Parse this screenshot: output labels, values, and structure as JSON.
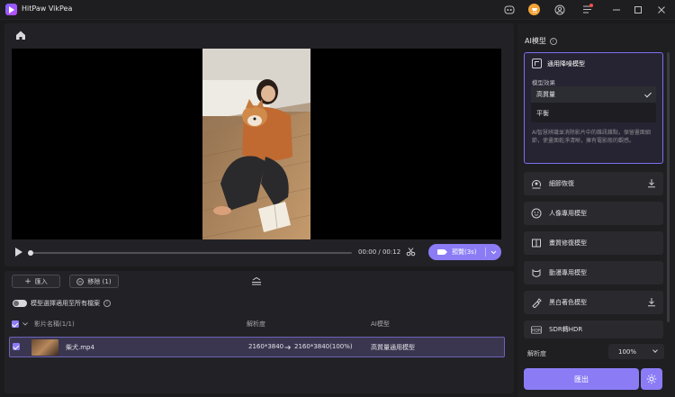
{
  "app": {
    "title": "HitPaw VikPea"
  },
  "titlebar": {
    "icons": [
      "discord-icon",
      "cart-icon",
      "account-icon",
      "menu-icon",
      "minimize-icon",
      "maximize-icon",
      "close-icon"
    ]
  },
  "player": {
    "time": "00:00 / 00:12",
    "preview_label": "預覽(3s)"
  },
  "file_list": {
    "import_label": "匯入",
    "remove_label": "移除 (1)",
    "apply_all_label": "模型選擇適用至所有檔案",
    "headers": {
      "name": "影片名稱(1/1)",
      "resolution": "解析度",
      "model": "AI模型"
    },
    "rows": [
      {
        "name": "柴犬.mp4",
        "res_from": "2160*3840",
        "res_to": "2160*3840(100%)",
        "model": "高質量通用模型"
      }
    ]
  },
  "right_panel": {
    "title": "AI模型",
    "active_model": {
      "name": "通用降噪模型",
      "effect_label": "模型效果",
      "options": [
        "高質量",
        "平衡"
      ],
      "selected": "高質量",
      "description": "AI智慧辨識並消除影片中的雜訊雜點，保留畫面細節，使畫面乾淨清晰，擁有電影般的觀感。"
    },
    "models": [
      {
        "name": "細節恢復",
        "icon": "detail-restore-icon",
        "download": true
      },
      {
        "name": "人像專用模型",
        "icon": "face-icon",
        "download": false
      },
      {
        "name": "畫質修復模型",
        "icon": "frame-icon",
        "download": false
      },
      {
        "name": "動漫專用模型",
        "icon": "anime-icon",
        "download": false
      },
      {
        "name": "黑白著色模型",
        "icon": "colorize-icon",
        "download": true
      },
      {
        "name": "SDR轉HDR",
        "icon": "hdr-icon",
        "download": false
      }
    ],
    "resolution_label": "解析度",
    "resolution_value": "100%",
    "export_label": "匯出"
  }
}
